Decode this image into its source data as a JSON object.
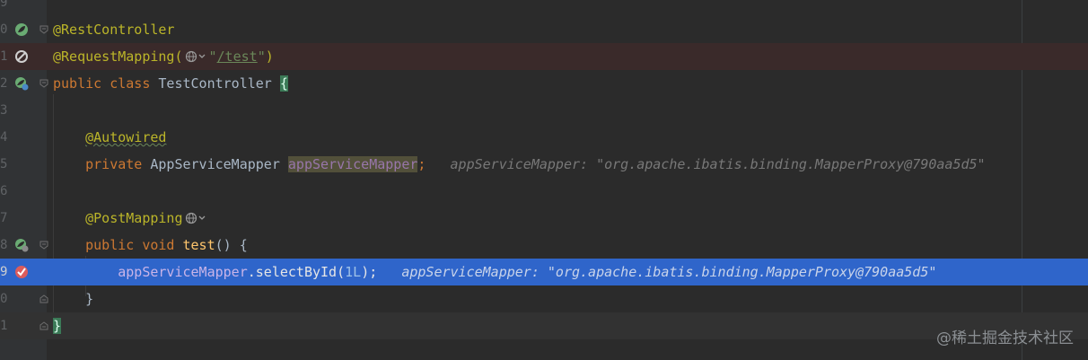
{
  "editor": {
    "line_numbers": [
      "9",
      "0",
      "1",
      "2",
      "3",
      "4",
      "5",
      "6",
      "7",
      "8",
      "9",
      "0",
      "1"
    ],
    "lines": {
      "l0": {
        "ann": "@RestController"
      },
      "l1": {
        "ann": "@RequestMapping(",
        "str_open": "\"",
        "path": "/test",
        "str_close": "\"",
        "close": ")"
      },
      "l2": {
        "kw": "public class ",
        "name": "TestController ",
        "brace": "{"
      },
      "l4": {
        "ann": "@Autowired"
      },
      "l5": {
        "kw": "private ",
        "type": "AppServiceMapper ",
        "field": "appServiceMapper",
        "semi": ";",
        "hint": "appServiceMapper: \"org.apache.ibatis.binding.MapperProxy@790aa5d5\""
      },
      "l7": {
        "ann": "@PostMapping"
      },
      "l8": {
        "kw": "public void ",
        "method": "test",
        "rest": "() {"
      },
      "l9": {
        "field": "appServiceMapper",
        "call": ".selectById(",
        "num": "1L",
        "end": ");",
        "hint": "appServiceMapper: \"org.apache.ibatis.binding.MapperProxy@790aa5d5\""
      },
      "l10": {
        "brace": "}"
      },
      "l11": {
        "brace": "}"
      }
    }
  },
  "watermark": "@稀土掘金技术社区",
  "colors": {
    "background": "#2b2b2b",
    "gutter": "#313335",
    "annotation": "#bbb529",
    "keyword": "#cc7832",
    "string": "#6a8759",
    "field": "#9876aa",
    "number": "#6897bb",
    "execution_line": "#2f65ca",
    "disabled_breakpoint_line": "#3a2a2a"
  },
  "icons": {
    "line0": "spring-bean-icon",
    "line1": "disabled-breakpoint-icon",
    "line2": "spring-bean-web-icon",
    "line8": "spring-web-endpoint-icon",
    "line9": "breakpoint-icon"
  }
}
